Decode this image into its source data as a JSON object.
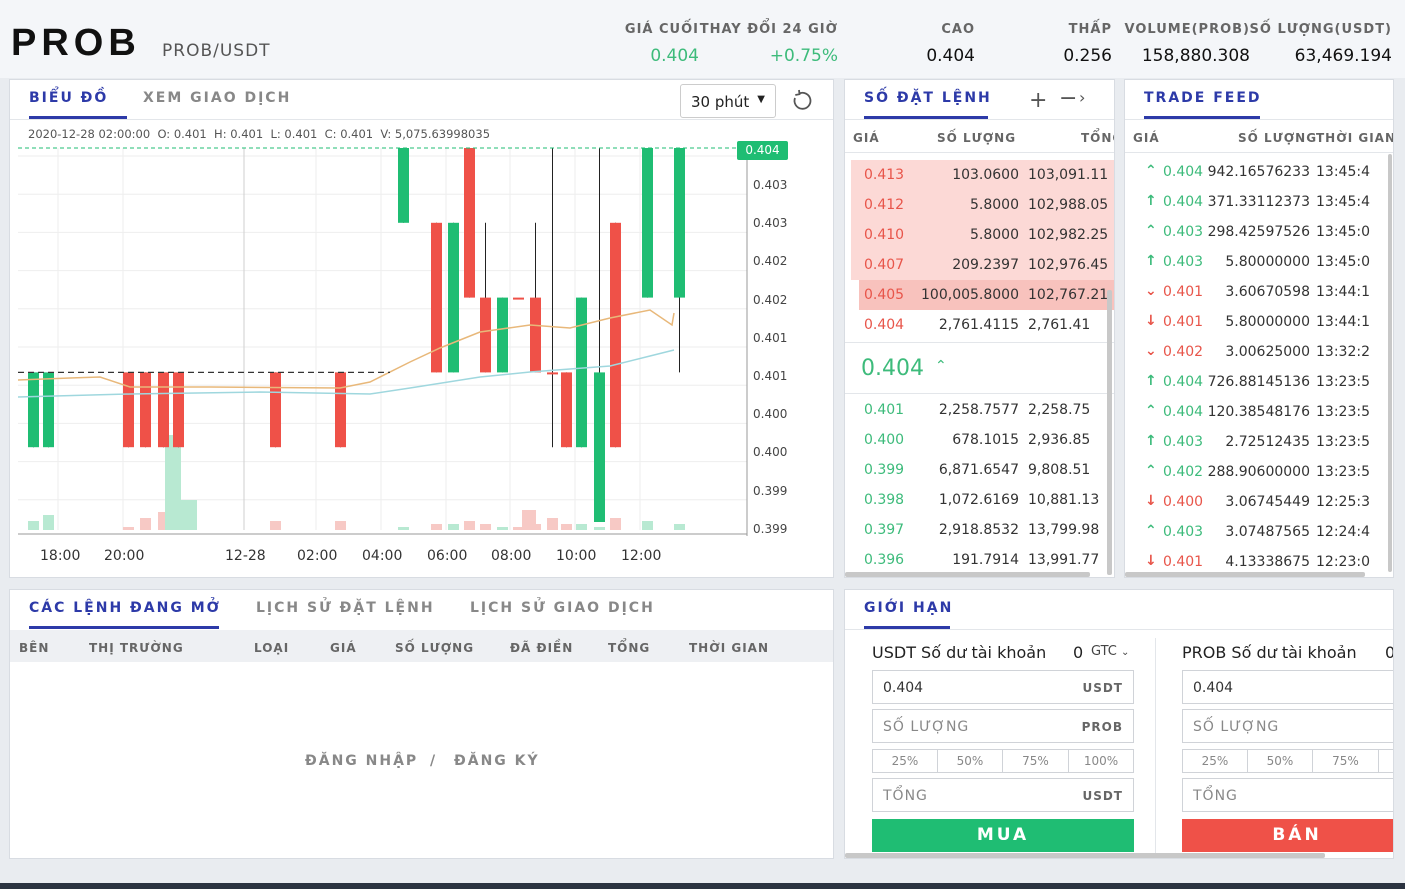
{
  "header": {
    "symbol": "PROB",
    "pair": "PROB/USDT",
    "stats": [
      {
        "label": "GIÁ CUỐI",
        "value": "0.404",
        "tone": "green"
      },
      {
        "label": "THAY ĐỔI 24 GIỜ",
        "value": "+0.75%",
        "tone": "green"
      },
      {
        "label": "CAO",
        "value": "0.404",
        "tone": "dark"
      },
      {
        "label": "THẤP",
        "value": "0.256",
        "tone": "dark"
      },
      {
        "label": "VOLUME(PROB)",
        "value": "158,880.308",
        "tone": "dark"
      },
      {
        "label": "SỐ LƯỢNG(USDT)",
        "value": "63,469.194",
        "tone": "dark"
      }
    ]
  },
  "chart_panel": {
    "tabs": [
      "BIỂU ĐỒ",
      "XEM GIAO DỊCH"
    ],
    "interval": "30 phút",
    "ohlc_line": "2020-12-28 02:00:00  O: 0.401  H: 0.401  L: 0.401  C: 0.401  V: 5,075.63998035",
    "current_price": "0.404",
    "y_ticks": [
      "0.403",
      "0.403",
      "0.402",
      "0.402",
      "0.401",
      "0.401",
      "0.400",
      "0.400",
      "0.399",
      "0.399"
    ],
    "x_ticks": [
      "18:00",
      "20:00",
      "12-28",
      "02:00",
      "04:00",
      "06:00",
      "08:00",
      "10:00",
      "12:00"
    ]
  },
  "chart_data": {
    "type": "candlestick",
    "colors": {
      "up": "#1fbd73",
      "down": "#ef5148",
      "ma1": "#e8b87a",
      "ma2": "#9fd7de"
    },
    "candles": [
      {
        "o": 0.4,
        "h": 0.401,
        "l": 0.4,
        "c": 0.401,
        "up": true
      },
      {
        "o": 0.4,
        "h": 0.401,
        "l": 0.4,
        "c": 0.401,
        "up": true
      },
      {
        "o": 0.401,
        "h": 0.401,
        "l": 0.4,
        "c": 0.4,
        "up": false
      },
      {
        "o": 0.401,
        "h": 0.401,
        "l": 0.4,
        "c": 0.4,
        "up": false
      },
      {
        "o": 0.401,
        "h": 0.401,
        "l": 0.4,
        "c": 0.4,
        "up": false
      },
      {
        "o": 0.401,
        "h": 0.401,
        "l": 0.4,
        "c": 0.4,
        "up": false
      },
      {
        "o": 0.401,
        "h": 0.401,
        "l": 0.4,
        "c": 0.4,
        "up": false
      },
      {
        "o": 0.401,
        "h": 0.401,
        "l": 0.4,
        "c": 0.4,
        "up": false
      },
      {
        "o": 0.404,
        "h": 0.404,
        "l": 0.403,
        "c": 0.403,
        "up": true
      },
      {
        "o": 0.403,
        "h": 0.403,
        "l": 0.401,
        "c": 0.401,
        "up": false
      },
      {
        "o": 0.401,
        "h": 0.403,
        "l": 0.401,
        "c": 0.403,
        "up": true
      },
      {
        "o": 0.404,
        "h": 0.404,
        "l": 0.402,
        "c": 0.402,
        "up": false
      },
      {
        "o": 0.402,
        "h": 0.403,
        "l": 0.401,
        "c": 0.401,
        "up": false
      },
      {
        "o": 0.401,
        "h": 0.402,
        "l": 0.401,
        "c": 0.402,
        "up": true
      },
      {
        "o": 0.402,
        "h": 0.402,
        "l": 0.402,
        "c": 0.402,
        "up": false
      },
      {
        "o": 0.402,
        "h": 0.403,
        "l": 0.401,
        "c": 0.401,
        "up": false
      },
      {
        "o": 0.401,
        "h": 0.404,
        "l": 0.4,
        "c": 0.401,
        "up": false
      },
      {
        "o": 0.401,
        "h": 0.401,
        "l": 0.4,
        "c": 0.4,
        "up": false
      },
      {
        "o": 0.4,
        "h": 0.402,
        "l": 0.4,
        "c": 0.402,
        "up": true
      },
      {
        "o": 0.401,
        "h": 0.404,
        "l": 0.399,
        "c": 0.399,
        "up": true
      },
      {
        "o": 0.403,
        "h": 0.403,
        "l": 0.4,
        "c": 0.4,
        "up": false
      },
      {
        "o": 0.402,
        "h": 0.404,
        "l": 0.402,
        "c": 0.404,
        "up": true
      },
      {
        "o": 0.402,
        "h": 0.404,
        "l": 0.401,
        "c": 0.404,
        "up": true
      }
    ]
  },
  "orderbook": {
    "title": "SỐ ĐẶT LỆNH",
    "cols": [
      "GIÁ",
      "SỐ LƯỢNG",
      "TỔNG"
    ],
    "asks": [
      {
        "price": "0.413",
        "qty": "103.0600",
        "total": "103,091.11"
      },
      {
        "price": "0.412",
        "qty": "5.8000",
        "total": "102,988.05"
      },
      {
        "price": "0.410",
        "qty": "5.8000",
        "total": "102,982.25"
      },
      {
        "price": "0.407",
        "qty": "209.2397",
        "total": "102,976.45"
      },
      {
        "price": "0.405",
        "qty": "100,005.8000",
        "total": "102,767.21"
      },
      {
        "price": "0.404",
        "qty": "2,761.4115",
        "total": "2,761.41"
      }
    ],
    "mid": "0.404",
    "bids": [
      {
        "price": "0.401",
        "qty": "2,258.7577",
        "total": "2,258.75"
      },
      {
        "price": "0.400",
        "qty": "678.1015",
        "total": "2,936.85"
      },
      {
        "price": "0.399",
        "qty": "6,871.6547",
        "total": "9,808.51"
      },
      {
        "price": "0.398",
        "qty": "1,072.6169",
        "total": "10,881.13"
      },
      {
        "price": "0.397",
        "qty": "2,918.8532",
        "total": "13,799.98"
      },
      {
        "price": "0.396",
        "qty": "191.7914",
        "total": "13,991.77"
      }
    ]
  },
  "trade_feed": {
    "title": "TRADE FEED",
    "cols": [
      "GIÁ",
      "SỐ LƯỢNG",
      "THỜI GIAN"
    ],
    "rows": [
      {
        "dir": "up",
        "price": "0.404",
        "qty": "942.16576233",
        "time": "13:45:4"
      },
      {
        "dir": "up",
        "price": "0.404",
        "qty": "371.33112373",
        "time": "13:45:4"
      },
      {
        "dir": "up",
        "price": "0.403",
        "qty": "298.42597526",
        "time": "13:45:0"
      },
      {
        "dir": "up",
        "price": "0.403",
        "qty": "5.80000000",
        "time": "13:45:0"
      },
      {
        "dir": "down",
        "price": "0.401",
        "qty": "3.60670598",
        "time": "13:44:1"
      },
      {
        "dir": "down",
        "price": "0.401",
        "qty": "5.80000000",
        "time": "13:44:1"
      },
      {
        "dir": "down",
        "price": "0.402",
        "qty": "3.00625000",
        "time": "13:32:2"
      },
      {
        "dir": "up",
        "price": "0.404",
        "qty": "726.88145136",
        "time": "13:23:5"
      },
      {
        "dir": "up",
        "price": "0.404",
        "qty": "120.38548176",
        "time": "13:23:5"
      },
      {
        "dir": "up",
        "price": "0.403",
        "qty": "2.72512435",
        "time": "13:23:5"
      },
      {
        "dir": "up",
        "price": "0.402",
        "qty": "288.90600000",
        "time": "13:23:5"
      },
      {
        "dir": "down",
        "price": "0.400",
        "qty": "3.06745449",
        "time": "12:25:3"
      },
      {
        "dir": "up",
        "price": "0.403",
        "qty": "3.07487565",
        "time": "12:24:4"
      },
      {
        "dir": "down",
        "price": "0.401",
        "qty": "4.13338675",
        "time": "12:23:0"
      }
    ]
  },
  "orders": {
    "tabs": [
      "CÁC LỆNH ĐANG MỞ",
      "LỊCH SỬ ĐẶT LỆNH",
      "LỊCH SỬ GIAO DỊCH"
    ],
    "cols": [
      "BÊN",
      "THỊ TRƯỜNG",
      "LOẠI",
      "GIÁ",
      "SỐ LƯỢNG",
      "ĐÃ ĐIỀN",
      "TỔNG",
      "THỜI GIAN"
    ],
    "login": "ĐĂNG NHẬP",
    "sep": "/",
    "register": "ĐĂNG KÝ"
  },
  "trade_form": {
    "title": "GIỚI HẠN",
    "buy": {
      "balance_label": "USDT Số dư tài khoản",
      "balance_value": "0",
      "tif": "GTC",
      "price": "0.404",
      "price_unit": "USDT",
      "qty_placeholder": "SỐ LƯỢNG",
      "qty_unit": "PROB",
      "pcts": [
        "25%",
        "50%",
        "75%",
        "100%"
      ],
      "total_placeholder": "TỔNG",
      "total_unit": "USDT",
      "button": "MUA"
    },
    "sell": {
      "balance_label": "PROB Số dư tài khoản",
      "balance_value": "0",
      "price": "0.404",
      "qty_placeholder": "SỐ LƯỢNG",
      "pcts": [
        "25%",
        "50%",
        "75%"
      ],
      "total_placeholder": "TỔNG",
      "button": "BÁN"
    }
  }
}
